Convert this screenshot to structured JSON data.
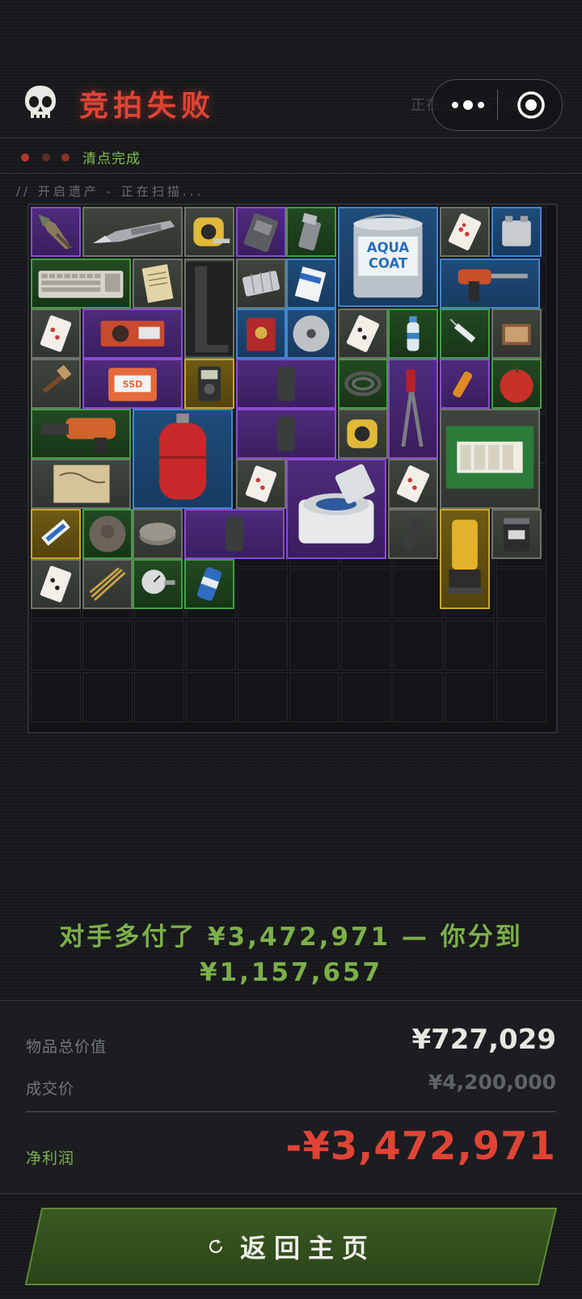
{
  "header": {
    "title": "竞拍失败",
    "ghost_text": "正在这个遗产情...",
    "skull_icon": "skull-icon",
    "more_icon": "more-dots-icon",
    "target_icon": "target-icon"
  },
  "status": {
    "text": "清点完成"
  },
  "scan": {
    "text": "// 开启遗产 - 正在扫描..."
  },
  "inventory": {
    "rarity_colors": {
      "purple": "#8a4bd4",
      "green": "#41a043",
      "blue": "#3f86cf",
      "gray": "#6d7467",
      "gold": "#c8a62b"
    },
    "items": [
      {
        "name": "spearhead",
        "rarity": "purple"
      },
      {
        "name": "utility-knife",
        "rarity": "gray"
      },
      {
        "name": "tape-measure",
        "rarity": "gray"
      },
      {
        "name": "hard-drive",
        "rarity": "purple"
      },
      {
        "name": "lighter",
        "rarity": "green"
      },
      {
        "name": "paint-bucket",
        "rarity": "blue",
        "label_line1": "AQUA",
        "label_line2": "COAT"
      },
      {
        "name": "playing-card",
        "rarity": "gray"
      },
      {
        "name": "battery-block",
        "rarity": "blue"
      },
      {
        "name": "keyboard",
        "rarity": "green"
      },
      {
        "name": "old-paper",
        "rarity": "gray"
      },
      {
        "name": "bracket",
        "rarity": "gray"
      },
      {
        "name": "container-tray",
        "rarity": "gray"
      },
      {
        "name": "medicine-box",
        "rarity": "blue"
      },
      {
        "name": "power-drill",
        "rarity": "blue"
      },
      {
        "name": "playing-card",
        "rarity": "gray"
      },
      {
        "name": "graphics-card",
        "rarity": "purple"
      },
      {
        "name": "red-tin",
        "rarity": "blue"
      },
      {
        "name": "saw-blade",
        "rarity": "blue"
      },
      {
        "name": "playing-card",
        "rarity": "gray"
      },
      {
        "name": "water-bottle",
        "rarity": "green"
      },
      {
        "name": "syringe",
        "rarity": "green"
      },
      {
        "name": "matchbox",
        "rarity": "gray"
      },
      {
        "name": "paintbrush",
        "rarity": "gray"
      },
      {
        "name": "ssd-box",
        "rarity": "purple",
        "label": "SSD"
      },
      {
        "name": "multimeter",
        "rarity": "gold"
      },
      {
        "name": "armor-plate",
        "rarity": "purple"
      },
      {
        "name": "coiled-hose",
        "rarity": "green"
      },
      {
        "name": "wrench-pliers",
        "rarity": "purple"
      },
      {
        "name": "orange-flare",
        "rarity": "purple"
      },
      {
        "name": "apple",
        "rarity": "green"
      },
      {
        "name": "hammer-drill",
        "rarity": "green"
      },
      {
        "name": "gas-cylinder",
        "rarity": "blue"
      },
      {
        "name": "armor-plate",
        "rarity": "purple"
      },
      {
        "name": "tape-measure",
        "rarity": "gray"
      },
      {
        "name": "candles-box",
        "rarity": "gray"
      },
      {
        "name": "treasure-map",
        "rarity": "gray"
      },
      {
        "name": "playing-card",
        "rarity": "gray"
      },
      {
        "name": "centrifuge",
        "rarity": "purple"
      },
      {
        "name": "playing-card",
        "rarity": "gray"
      },
      {
        "name": "toothbrush-pack",
        "rarity": "gold"
      },
      {
        "name": "old-coin",
        "rarity": "green"
      },
      {
        "name": "grinding-wheel",
        "rarity": "gray"
      },
      {
        "name": "armor-plate-long",
        "rarity": "purple"
      },
      {
        "name": "pepper-grinder",
        "rarity": "gray"
      },
      {
        "name": "coffee-machine",
        "rarity": "gold"
      },
      {
        "name": "protein-tub",
        "rarity": "gray"
      },
      {
        "name": "playing-card",
        "rarity": "gray"
      },
      {
        "name": "rope-bundle",
        "rarity": "gray"
      },
      {
        "name": "pressure-gauge",
        "rarity": "green"
      },
      {
        "name": "soda-can",
        "rarity": "green"
      }
    ]
  },
  "summary": {
    "split_message": "对手多付了 ¥3,472,971 — 你分到 ¥1,157,657",
    "total_label": "物品总价值",
    "total_value": "¥727,029",
    "deal_label": "成交价",
    "deal_value": "¥4,200,000",
    "net_label": "净利润",
    "net_value": "-¥3,472,971",
    "net_color": "#e04434",
    "accent_color": "#7cb04a"
  },
  "actions": {
    "return_label": "返回主页",
    "return_icon": "refresh-icon"
  }
}
